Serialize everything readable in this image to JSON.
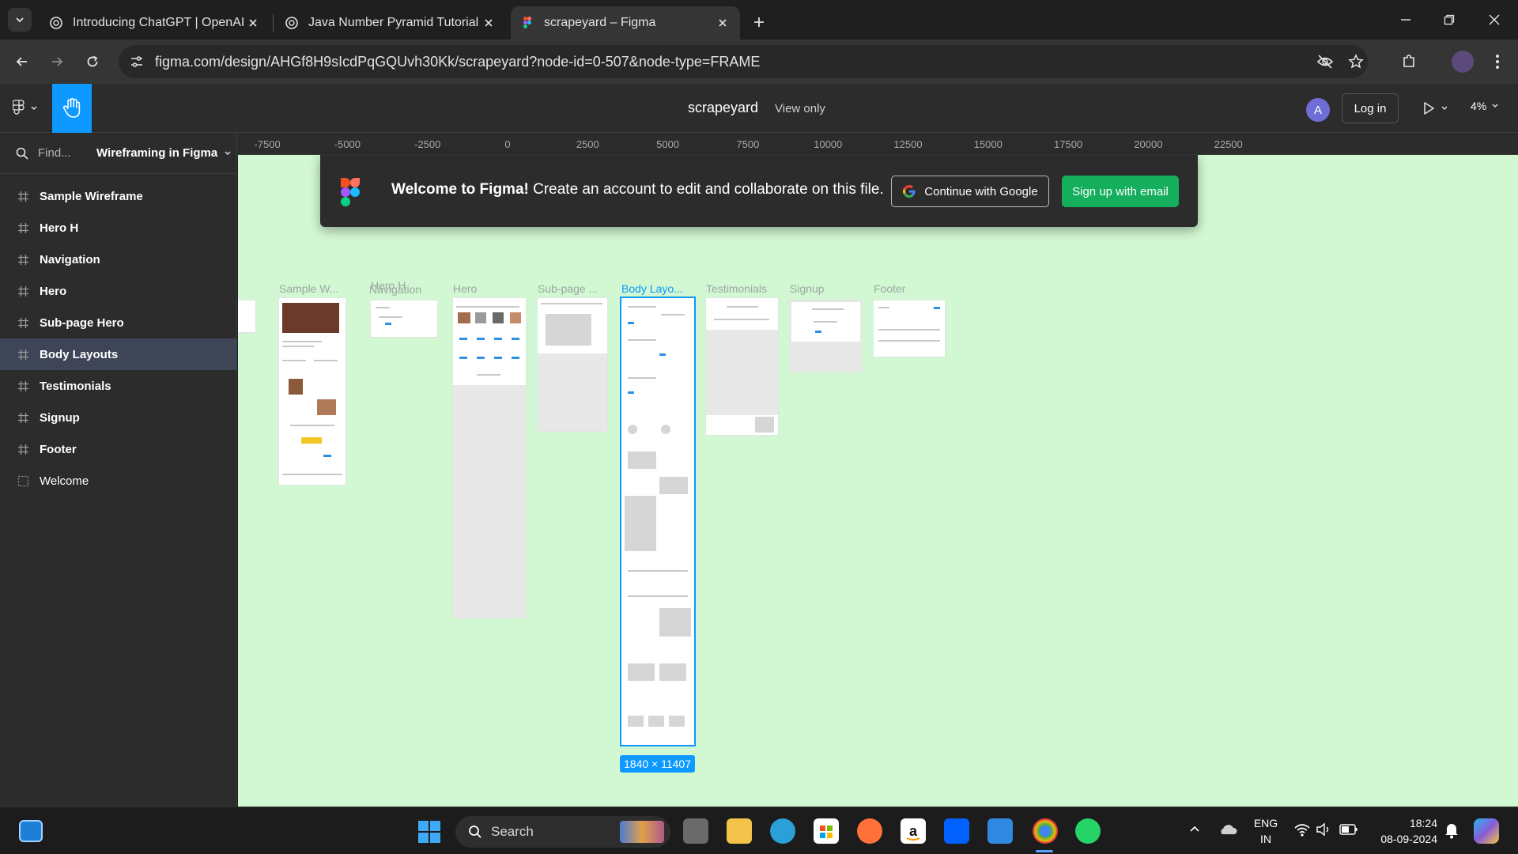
{
  "browser": {
    "tabs": [
      {
        "title": "Introducing ChatGPT | OpenAI",
        "active": false
      },
      {
        "title": "Java Number Pyramid Tutorial",
        "active": false
      },
      {
        "title": "scrapeyard – Figma",
        "active": true
      }
    ],
    "url": "figma.com/design/AHGf8H9sIcdPqGQUvh30Kk/scrapeyard?node-id=0-507&node-type=FRAME"
  },
  "figma": {
    "file_name": "scrapeyard",
    "view_mode": "View only",
    "avatar_initial": "A",
    "login_label": "Log in",
    "zoom": "4%",
    "find_placeholder": "Find...",
    "page_name": "Wireframing in Figma",
    "layers": [
      {
        "label": "Sample Wireframe",
        "selected": false
      },
      {
        "label": "Hero H",
        "selected": false
      },
      {
        "label": "Navigation",
        "selected": false
      },
      {
        "label": "Hero",
        "selected": false
      },
      {
        "label": "Sub-page Hero",
        "selected": false
      },
      {
        "label": "Body Layouts",
        "selected": true
      },
      {
        "label": "Testimonials",
        "selected": false
      },
      {
        "label": "Signup",
        "selected": false
      },
      {
        "label": "Footer",
        "selected": false
      },
      {
        "label": "Welcome",
        "selected": false
      }
    ],
    "ruler_ticks": [
      "-7500",
      "-5000",
      "-2500",
      "0",
      "2500",
      "5000",
      "7500",
      "10000",
      "12500",
      "15000",
      "17500",
      "20000",
      "22500"
    ],
    "frames": [
      {
        "label": "Sample W..."
      },
      {
        "label": "Hero H"
      },
      {
        "label": "Navigation"
      },
      {
        "label": "Hero"
      },
      {
        "label": "Sub-page ..."
      },
      {
        "label": "Body Layo..."
      },
      {
        "label": "Testimonials"
      },
      {
        "label": "Signup"
      },
      {
        "label": "Footer"
      }
    ],
    "selection_size": "1840 × 11407",
    "banner": {
      "bold": "Welcome to Figma!",
      "text": "Create an account to edit and collaborate on this file.",
      "google_button": "Continue with Google",
      "email_button": "Sign up with email"
    },
    "colors": {
      "accent": "#0d99ff",
      "canvas": "#d2f7d3",
      "signup_green": "#14ae5c"
    }
  },
  "taskbar": {
    "search_label": "Search",
    "lang_top": "ENG",
    "lang_bottom": "IN",
    "time": "18:24",
    "date": "08-09-2024"
  }
}
